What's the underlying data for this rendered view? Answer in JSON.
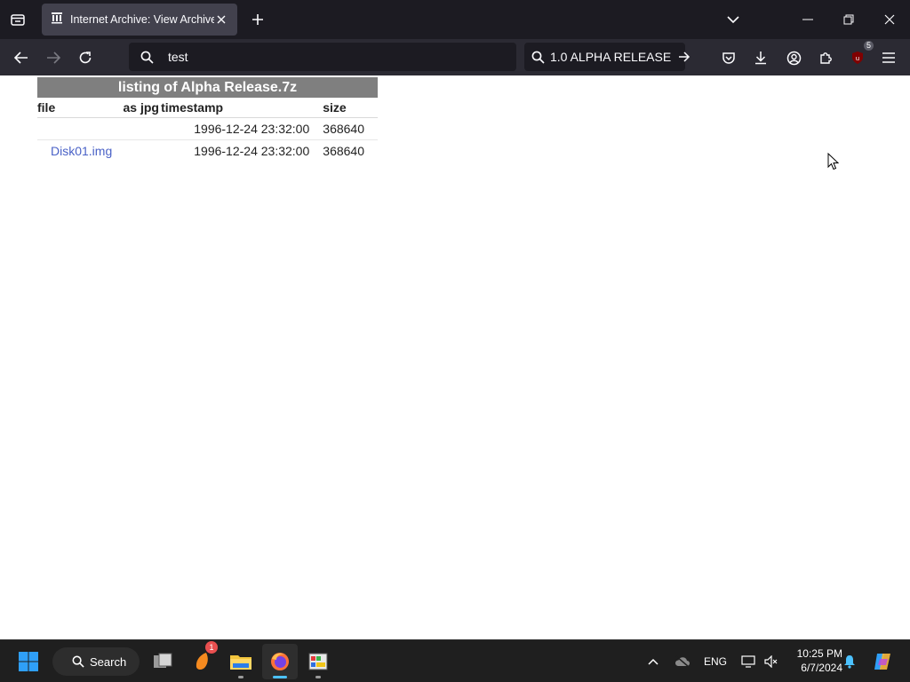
{
  "browser": {
    "tab": {
      "title": "Internet Archive: View Archive",
      "icon": "archive-columns-icon"
    },
    "url": "test",
    "search": "1.0 ALPHA RELEASE",
    "extension_badge": "5"
  },
  "listing": {
    "caption": "listing of Alpha Release.7z",
    "headers": {
      "file": "file",
      "as_jpg": "as jpg",
      "timestamp": "timestamp",
      "size": "size"
    },
    "rows": [
      {
        "file": "",
        "timestamp": "1996-12-24 23:32:00",
        "size": "368640"
      },
      {
        "file": "Disk01.img",
        "timestamp": "1996-12-24 23:32:00",
        "size": "368640"
      }
    ]
  },
  "taskbar": {
    "search_label": "Search",
    "app_badge": "1",
    "language": "ENG",
    "time": "10:25 PM",
    "date": "6/7/2024"
  },
  "colors": {
    "tabbar": "#1c1b22",
    "navbar": "#2b2a33",
    "caption_bg": "#7f7f7f",
    "link": "#4a62c7",
    "taskbar": "#1f1f1f"
  }
}
